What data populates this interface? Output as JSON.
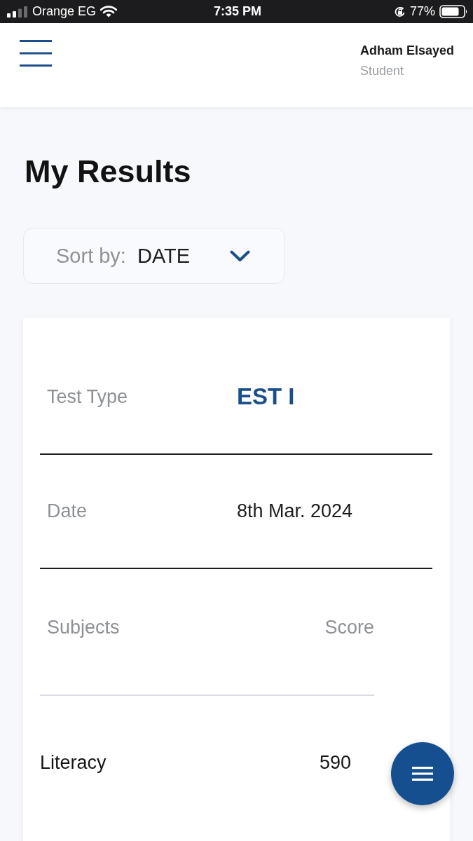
{
  "status_bar": {
    "carrier": "Orange EG",
    "time": "7:35 PM",
    "battery": "77%"
  },
  "header": {
    "user_name": "Adham Elsayed",
    "user_role": "Student"
  },
  "page": {
    "title": "My Results"
  },
  "sort": {
    "label": "Sort by:",
    "value": "DATE"
  },
  "result_card": {
    "fields": [
      {
        "label": "Test Type",
        "value": "EST I",
        "kind": "highlight"
      },
      {
        "label": "Date",
        "value": "8th Mar. 2024",
        "kind": "plain"
      }
    ],
    "table": {
      "columns": [
        "Subjects",
        "Score"
      ],
      "rows": [
        {
          "subject": "Literacy",
          "score": "590"
        }
      ]
    }
  }
}
